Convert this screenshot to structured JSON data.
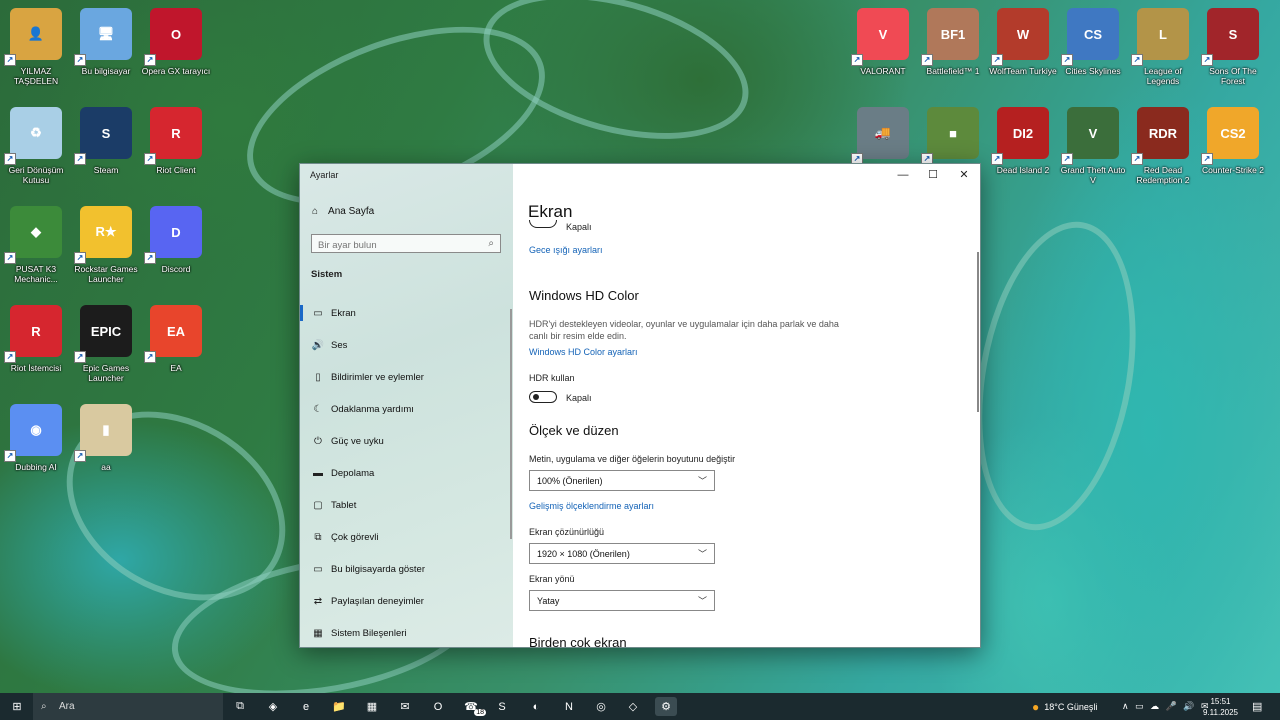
{
  "desktop": {
    "left_icons": [
      {
        "label": "YILMAZ TAŞDELEN",
        "glyph": "👤",
        "color": "#d9a441"
      },
      {
        "label": "Bu bilgisayar",
        "glyph": "🖥",
        "color": "#6aa7e0"
      },
      {
        "label": "Opera GX tarayıcı",
        "glyph": "O",
        "color": "#c0162c"
      },
      {
        "label": "Geri Dönüşüm Kutusu",
        "glyph": "♻",
        "color": "#a9cfe6"
      },
      {
        "label": "Steam",
        "glyph": "S",
        "color": "#1b3c67"
      },
      {
        "label": "Riot Client",
        "glyph": "R",
        "color": "#d6262f"
      },
      {
        "label": "PUSAT K3 Mechanic...",
        "glyph": "◆",
        "color": "#3c8b3a"
      },
      {
        "label": "Rockstar Games Launcher",
        "glyph": "R★",
        "color": "#f2c12e"
      },
      {
        "label": "Discord",
        "glyph": "D",
        "color": "#5865f2"
      },
      {
        "label": "Riot İstemcisi",
        "glyph": "R",
        "color": "#d6262f"
      },
      {
        "label": "Epic Games Launcher",
        "glyph": "EPIC",
        "color": "#1c1c1c"
      },
      {
        "label": "EA",
        "glyph": "EA",
        "color": "#e8452c"
      },
      {
        "label": "Dubbing AI",
        "glyph": "◉",
        "color": "#5b8ff2"
      },
      {
        "label": "aa",
        "glyph": "▮",
        "color": "#d9c9a0"
      }
    ],
    "right_icons": [
      {
        "label": "VALORANT",
        "glyph": "V",
        "color": "#f04a54"
      },
      {
        "label": "Battlefield™ 1",
        "glyph": "BF1",
        "color": "#b0785a"
      },
      {
        "label": "WolfTeam Turkiye",
        "glyph": "W",
        "color": "#b33b2b"
      },
      {
        "label": "Cities Skylines",
        "glyph": "CS",
        "color": "#3f78c2"
      },
      {
        "label": "League of Legends",
        "glyph": "L",
        "color": "#b39448"
      },
      {
        "label": "Sons Of The Forest",
        "glyph": "S",
        "color": "#a1252a"
      },
      {
        "label": "",
        "glyph": "🚚",
        "color": "#6a7d86"
      },
      {
        "label": "",
        "glyph": "■",
        "color": "#5d8a3c"
      },
      {
        "label": "Dead Island 2",
        "glyph": "DI2",
        "color": "#b52020"
      },
      {
        "label": "Grand Theft Auto V",
        "glyph": "V",
        "color": "#3b6e3b"
      },
      {
        "label": "Red Dead Redemption 2",
        "glyph": "RDR",
        "color": "#8a2a1e"
      },
      {
        "label": "Counter-Strike 2",
        "glyph": "CS2",
        "color": "#f0a72a"
      }
    ]
  },
  "window": {
    "title": "Ayarlar",
    "controls": {
      "minimize": "—",
      "maximize": "☐",
      "close": "✕"
    },
    "sidebar": {
      "home_label": "Ana Sayfa",
      "search_placeholder": "Bir ayar bulun",
      "section_title": "Sistem",
      "items": [
        {
          "label": "Ekran",
          "icon": "▭",
          "active": true
        },
        {
          "label": "Ses",
          "icon": "🔊"
        },
        {
          "label": "Bildirimler ve eylemler",
          "icon": "▯"
        },
        {
          "label": "Odaklanma yardımı",
          "icon": "☾"
        },
        {
          "label": "Güç ve uyku",
          "icon": "⏻"
        },
        {
          "label": "Depolama",
          "icon": "▬"
        },
        {
          "label": "Tablet",
          "icon": "▢"
        },
        {
          "label": "Çok görevli",
          "icon": "⧉"
        },
        {
          "label": "Bu bilgisayarda göster",
          "icon": "▭"
        },
        {
          "label": "Paylaşılan deneyimler",
          "icon": "⇄"
        },
        {
          "label": "Sistem Bileşenleri",
          "icon": "▦"
        }
      ]
    },
    "main": {
      "title": "Ekran",
      "night_light_state": "Kapalı",
      "night_light_link": "Gece ışığı ayarları",
      "hd_title": "Windows HD Color",
      "hd_desc": "HDR'yi destekleyen videolar, oyunlar ve uygulamalar için daha parlak ve daha canlı bir resim elde edin.",
      "hd_link": "Windows HD Color ayarları",
      "hdr_label": "HDR kullan",
      "hdr_state": "Kapalı",
      "scale_title": "Ölçek ve düzen",
      "scale_label": "Metin, uygulama ve diğer öğelerin boyutunu değiştir",
      "scale_value": "100% (Önerilen)",
      "scale_link": "Gelişmiş ölçeklendirme ayarları",
      "resolution_label": "Ekran çözünürlüğü",
      "resolution_value": "1920 × 1080 (Önerilen)",
      "orientation_label": "Ekran yönü",
      "orientation_value": "Yatay",
      "multi_title": "Birden çok ekran"
    }
  },
  "taskbar": {
    "search_placeholder": "Ara",
    "apps": [
      "⧉",
      "◈",
      "e",
      "📁",
      "▦",
      "✉",
      "O",
      "☎",
      "S",
      "◐",
      "N",
      "◎",
      "◇",
      "⚙"
    ],
    "whatsapp_badge": "18",
    "weather": "18°C Güneşli",
    "tray_icons": "∧ ▭ ☁ 🎤 🔊 ✉",
    "time": "15:51",
    "date": "9.11.2025"
  }
}
